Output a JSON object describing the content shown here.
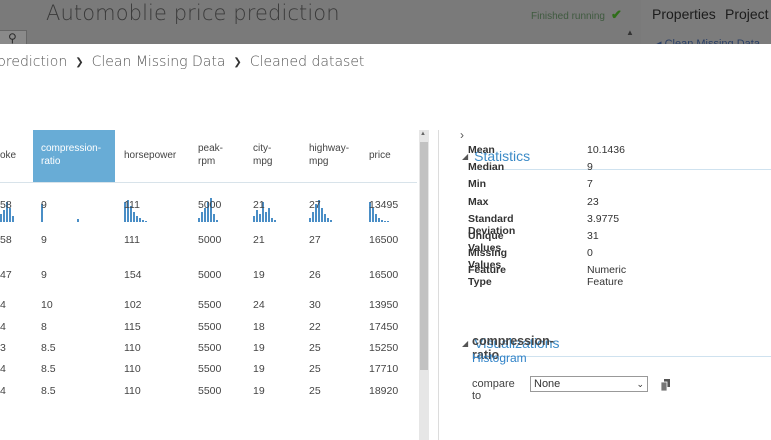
{
  "background_app": {
    "title": "Automoblie price prediction",
    "status": "Finished running",
    "status_icon": "check-icon",
    "tabs": [
      "Properties",
      "Project"
    ],
    "properties_subtitle": "Clean Missing Data"
  },
  "breadcrumb": [
    "prediction",
    "Clean Missing Data",
    "Cleaned dataset"
  ],
  "table": {
    "columns": [
      {
        "name": "oke",
        "selected": false
      },
      {
        "name": "compression-ratio",
        "selected": true
      },
      {
        "name": "horsepower",
        "selected": false
      },
      {
        "name": "peak-rpm",
        "selected": false
      },
      {
        "name": "city-mpg",
        "selected": false
      },
      {
        "name": "highway-mpg",
        "selected": false
      },
      {
        "name": "price",
        "selected": false
      }
    ],
    "rows": [
      [
        "58",
        "9",
        "111",
        "5000",
        "21",
        "27",
        "13495"
      ],
      [
        "58",
        "9",
        "111",
        "5000",
        "21",
        "27",
        "16500"
      ],
      [
        "47",
        "9",
        "154",
        "5000",
        "19",
        "26",
        "16500"
      ],
      [
        "4",
        "10",
        "102",
        "5500",
        "24",
        "30",
        "13950"
      ],
      [
        "4",
        "8",
        "115",
        "5500",
        "18",
        "22",
        "17450"
      ],
      [
        "3",
        "8.5",
        "110",
        "5500",
        "19",
        "25",
        "15250"
      ],
      [
        "4",
        "8.5",
        "110",
        "5500",
        "19",
        "25",
        "17710"
      ],
      [
        "4",
        "8.5",
        "110",
        "5500",
        "19",
        "25",
        "18920"
      ]
    ]
  },
  "statistics": {
    "title": "Statistics",
    "items": [
      {
        "label": "Mean",
        "value": "10.1436"
      },
      {
        "label": "Median",
        "value": "9"
      },
      {
        "label": "Min",
        "value": "7"
      },
      {
        "label": "Max",
        "value": "23"
      },
      {
        "label": "Standard Deviation",
        "value": "3.9775"
      },
      {
        "label": "Unique Values",
        "value": "31"
      },
      {
        "label": "Missing Values",
        "value": "0"
      },
      {
        "label": "Feature Type",
        "value": "Numeric Feature"
      }
    ]
  },
  "visualizations": {
    "title": "Visualizations",
    "column_name": "compression-ratio",
    "chart_type": "Histogram",
    "compare_label": "compare to",
    "compare_value": "None"
  },
  "colors": {
    "selected_header": "#68acd6",
    "histogram_bar": "#4a8ec6",
    "section_title": "#3c8bc7"
  }
}
